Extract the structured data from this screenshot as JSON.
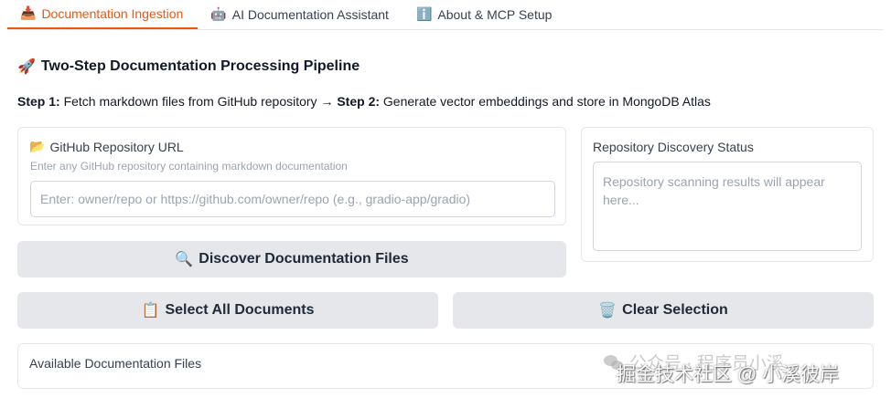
{
  "tabs": [
    {
      "icon": "📥",
      "label": "Documentation Ingestion",
      "active": true
    },
    {
      "icon": "🤖",
      "label": "AI Documentation Assistant",
      "active": false
    },
    {
      "icon": "ℹ️",
      "label": "About & MCP Setup",
      "active": false
    }
  ],
  "heading": {
    "icon": "🚀",
    "text": "Two-Step Documentation Processing Pipeline"
  },
  "steps": {
    "step1_label": "Step 1:",
    "step1_text": " Fetch markdown files from GitHub repository → ",
    "step2_label": "Step 2:",
    "step2_text": " Generate vector embeddings and store in MongoDB Atlas"
  },
  "repo_url": {
    "icon": "📂",
    "label": "GitHub Repository URL",
    "info": "Enter any GitHub repository containing markdown documentation",
    "placeholder": "Enter: owner/repo or https://github.com/owner/repo (e.g., gradio-app/gradio)",
    "value": ""
  },
  "discovery_status": {
    "label": "Repository Discovery Status",
    "placeholder": "Repository scanning results will appear here..."
  },
  "buttons": {
    "discover": {
      "icon": "🔍",
      "label": "Discover Documentation Files"
    },
    "select_all": {
      "icon": "📋",
      "label": "Select All Documents"
    },
    "clear": {
      "icon": "🗑️",
      "label": "Clear Selection"
    }
  },
  "available_files": {
    "label": "Available Documentation Files"
  },
  "watermark": {
    "top": "公众号 · 程序员小溪",
    "bottom": "掘金技术社区 @ 小溪彼岸"
  },
  "colors": {
    "accent": "#ea580c",
    "button_bg": "#e5e7eb",
    "border": "#e5e7eb"
  }
}
